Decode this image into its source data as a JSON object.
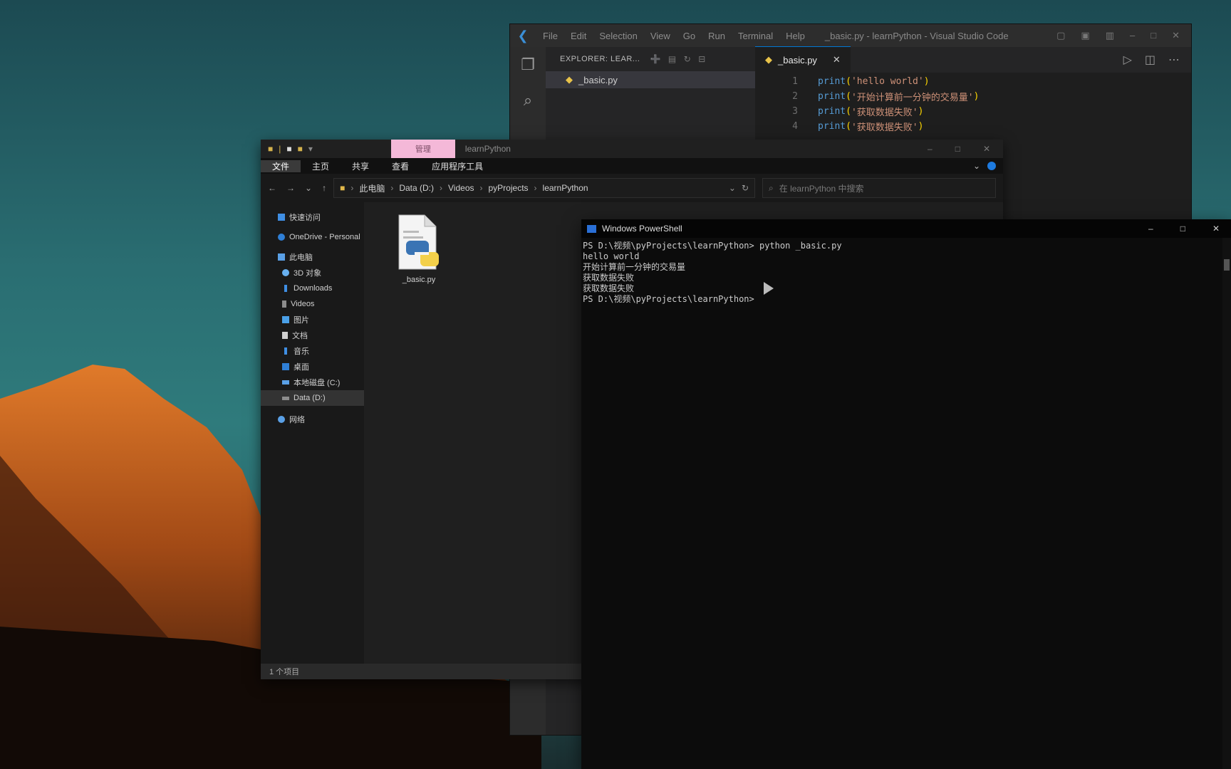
{
  "vscode": {
    "menu": [
      "File",
      "Edit",
      "Selection",
      "View",
      "Go",
      "Run",
      "Terminal",
      "Help"
    ],
    "window_title": "_basic.py - learnPython - Visual Studio Code",
    "explorer_header": "EXPLORER: LEAR...",
    "files": [
      "_basic.py"
    ],
    "tab_label": "_basic.py",
    "code_lines": [
      {
        "num": "1",
        "fn": "print",
        "arg": "'hello world'"
      },
      {
        "num": "2",
        "fn": "print",
        "arg": "'开始计算前一分钟的交易量'"
      },
      {
        "num": "3",
        "fn": "print",
        "arg": "'获取数据失败'"
      },
      {
        "num": "4",
        "fn": "print",
        "arg": "'获取数据失败'"
      }
    ]
  },
  "explorer": {
    "quick_access_sep": "|",
    "context_tab": "管理",
    "title": "learnPython",
    "ribbon": [
      "文件",
      "主页",
      "共享",
      "查看",
      "应用程序工具"
    ],
    "breadcrumb": [
      "此电脑",
      "Data (D:)",
      "Videos",
      "pyProjects",
      "learnPython"
    ],
    "search_placeholder": "在 learnPython 中搜索",
    "nav": [
      {
        "label": "快速访问",
        "sub": false,
        "color": "#3f8ee3"
      },
      {
        "label": "OneDrive - Personal",
        "sub": false,
        "color": "#2f7fd6"
      },
      {
        "label": "此电脑",
        "sub": false,
        "color": "#5aa0e6"
      },
      {
        "label": "3D 对象",
        "sub": true,
        "color": "#68b0f0"
      },
      {
        "label": "Downloads",
        "sub": true,
        "color": "#3f8ee3"
      },
      {
        "label": "Videos",
        "sub": true,
        "color": "#8c8c8c"
      },
      {
        "label": "图片",
        "sub": true,
        "color": "#4aa0e8"
      },
      {
        "label": "文档",
        "sub": true,
        "color": "#cfcfcf"
      },
      {
        "label": "音乐",
        "sub": true,
        "color": "#3f8ee3"
      },
      {
        "label": "桌面",
        "sub": true,
        "color": "#2f7fd6"
      },
      {
        "label": "本地磁盘 (C:)",
        "sub": true,
        "color": "#5aa0e6"
      },
      {
        "label": "Data (D:)",
        "sub": true,
        "color": "#8c8c8c",
        "selected": true
      },
      {
        "label": "网络",
        "sub": false,
        "color": "#5aa0e6"
      }
    ],
    "file_name": "_basic.py",
    "status": "1 个项目"
  },
  "powershell": {
    "title": "Windows PowerShell",
    "lines": [
      "PS D:\\视频\\pyProjects\\learnPython> python _basic.py",
      "hello world",
      "开始计算前一分钟的交易量",
      "获取数据失败",
      "获取数据失败",
      "PS D:\\视频\\pyProjects\\learnPython>"
    ]
  }
}
